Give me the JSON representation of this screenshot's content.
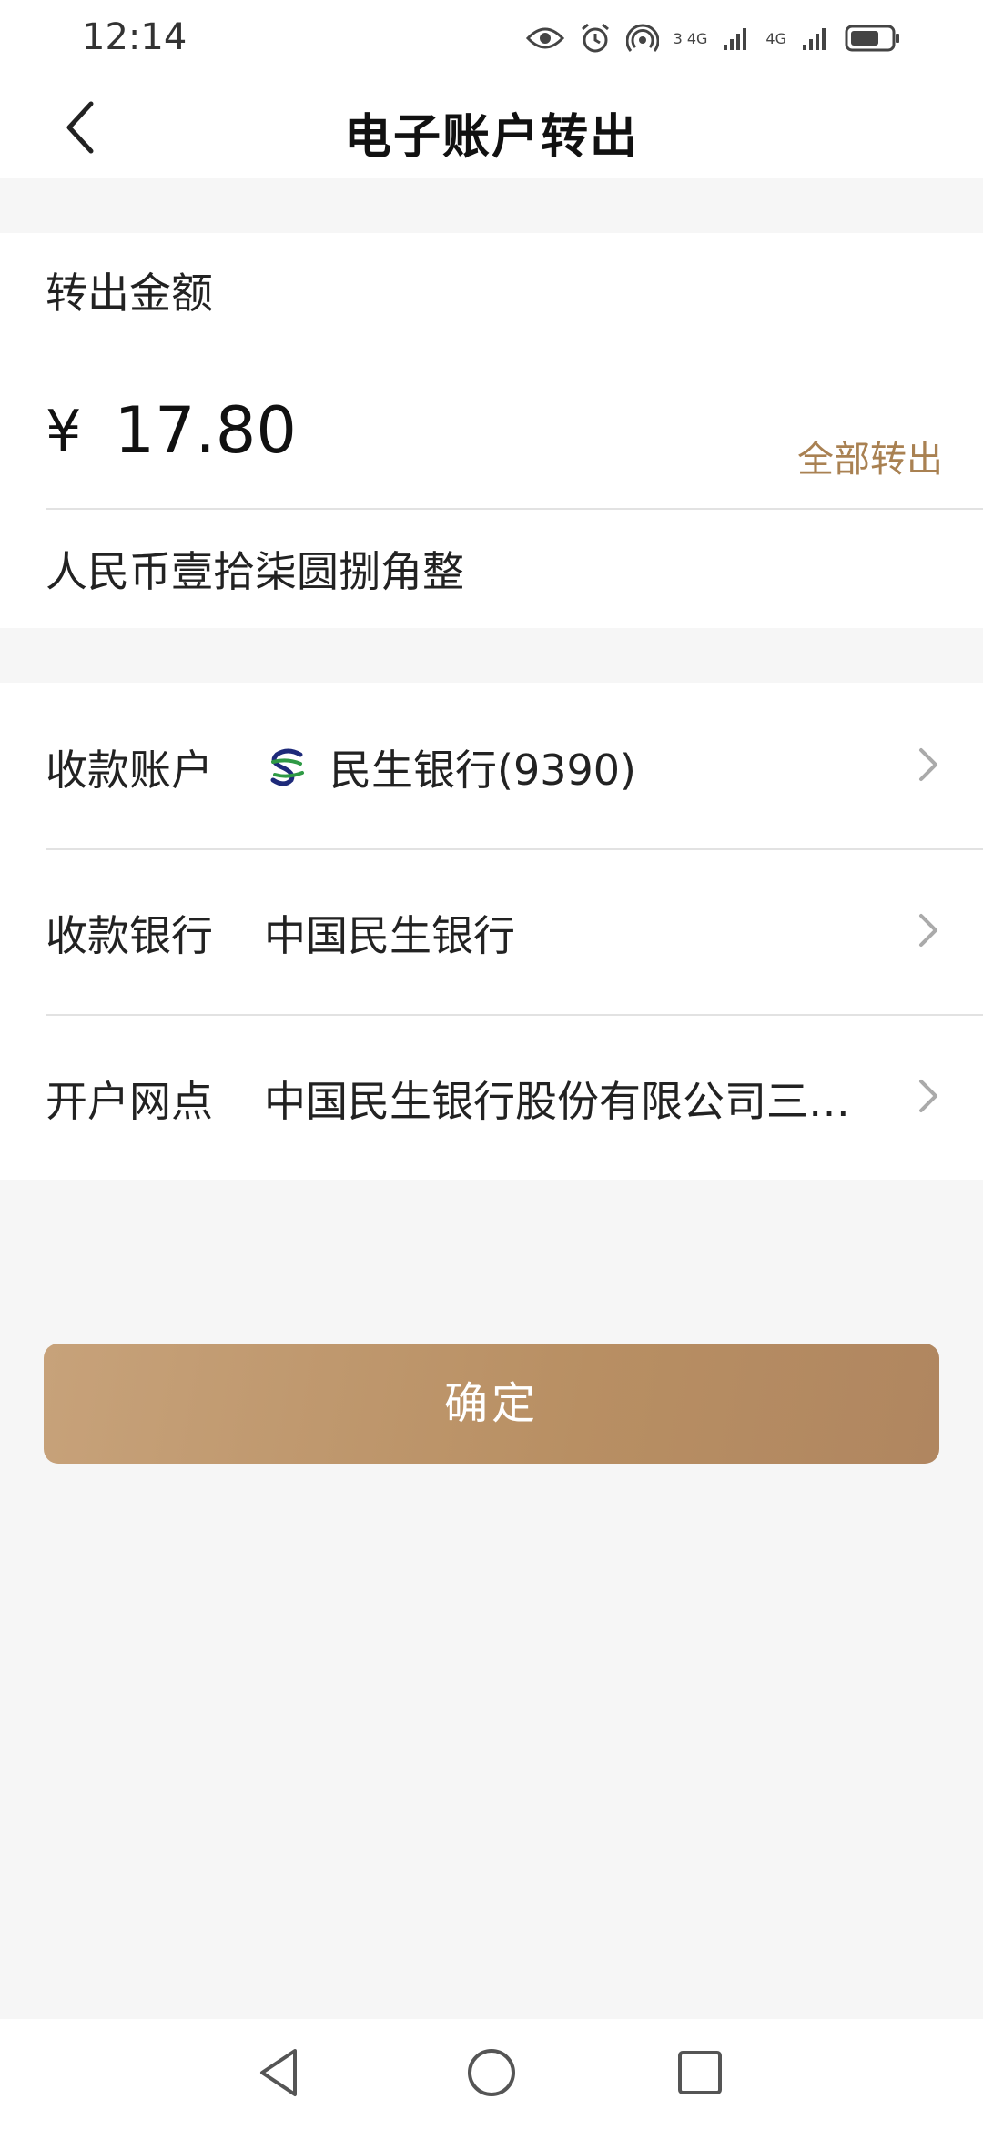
{
  "status_bar": {
    "time": "12:14",
    "network_label_1": "3 4G",
    "network_label_2": "4G",
    "icons": [
      "eye-icon",
      "alarm-icon",
      "hotspot-icon",
      "signal-icon",
      "signal-icon",
      "battery-icon"
    ]
  },
  "nav": {
    "title": "电子账户转出",
    "back_icon": "chevron-left-icon"
  },
  "amount": {
    "label": "转出金额",
    "currency_symbol": "¥",
    "value": "17.80",
    "transfer_all": "全部转出",
    "in_words": "人民币壹拾柒圆捌角整"
  },
  "rows": [
    {
      "label": "收款账户",
      "value": "民生银行(9390)",
      "has_logo": true
    },
    {
      "label": "收款银行",
      "value": "中国民生银行",
      "has_logo": false
    },
    {
      "label": "开户网点",
      "value": "中国民生银行股份有限公司三…",
      "has_logo": false
    }
  ],
  "confirm_label": "确定",
  "colors": {
    "accent": "#a98152",
    "button_start": "#c7a27a",
    "button_end": "#b08660",
    "background": "#f6f6f6"
  },
  "system_nav": {
    "icons": [
      "back-triangle-icon",
      "home-circle-icon",
      "recents-square-icon"
    ]
  }
}
